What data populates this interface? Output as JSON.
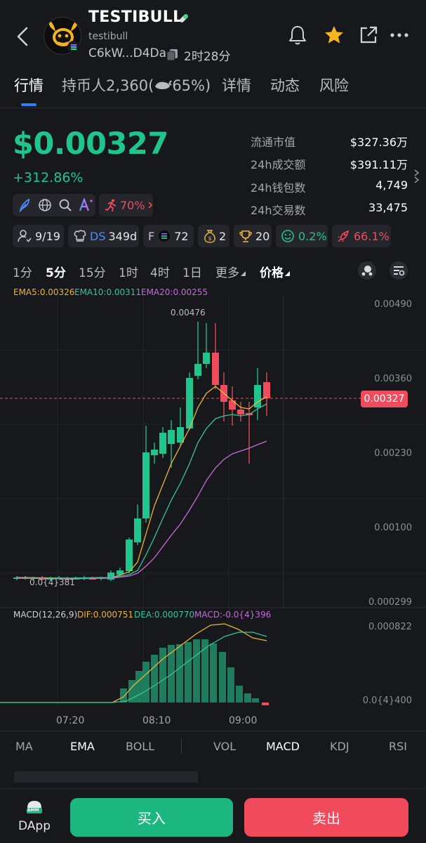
{
  "header": {
    "token_name": "TESTIBULL",
    "token_sub": "testibull",
    "address": "C6kW...D4Da",
    "age": "2时28分"
  },
  "tabs": [
    {
      "label": "行情"
    },
    {
      "label": "持币人2,360("
    },
    {
      "label": "65%)"
    },
    {
      "label": "详情"
    },
    {
      "label": "动态"
    },
    {
      "label": "风险"
    }
  ],
  "price": {
    "value": "$0.00327",
    "change": "+312.86%"
  },
  "stats": [
    {
      "label": "流通市值",
      "value": "$327.36万"
    },
    {
      "label": "24h成交额",
      "value": "$391.11万"
    },
    {
      "label": "24h钱包数",
      "value": "4,749"
    },
    {
      "label": "24h交易数",
      "value": "33,475"
    }
  ],
  "chips_row1": {
    "runner_pct": "70%"
  },
  "chips_row2": {
    "holders": "9/19",
    "ds_label": "DS",
    "ds_age": "349d",
    "f_label": "F",
    "f_value": "72",
    "bag": "2",
    "cup": "20",
    "smile": "0.2%",
    "rocket": "66.1%"
  },
  "timeframes": [
    {
      "label": "1分"
    },
    {
      "label": "5分"
    },
    {
      "label": "15分"
    },
    {
      "label": "1时"
    },
    {
      "label": "4时"
    },
    {
      "label": "1日"
    },
    {
      "label": "更多"
    },
    {
      "label": "价格"
    }
  ],
  "ema_legend": {
    "ema5": "EMA5:0.00326",
    "ema10": "EMA10:0.00311",
    "ema20": "EMA20:0.00255"
  },
  "price_axis": [
    "0.00490",
    "0.00360",
    "0.00230",
    "0.00100",
    "0.000299"
  ],
  "current_price_tag": "0.00327",
  "annotations": {
    "high": "0.00476",
    "low": "0.0{4}381"
  },
  "macd_legend": {
    "label": "MACD(12,26,9)",
    "dif": "DIF:0.000751",
    "dea": "DEA:0.000770",
    "macd": "MACD:-0.0{4}396"
  },
  "macd_axis": [
    "0.000822",
    "0.0{4}400"
  ],
  "time_axis": [
    "07:20",
    "08:10",
    "09:00"
  ],
  "indicators": [
    {
      "label": "MA"
    },
    {
      "label": "EMA"
    },
    {
      "label": "BOLL"
    },
    {
      "label": "VOL"
    },
    {
      "label": "MACD"
    },
    {
      "label": "KDJ"
    },
    {
      "label": "RSI"
    }
  ],
  "bottom": {
    "dapp": "DApp",
    "amm": "AMM",
    "buy": "买入",
    "sell": "卖出"
  },
  "colors": {
    "up": "#1fc58c",
    "down": "#ef4d5d",
    "ema5": "#e8b53a",
    "ema10": "#32c795",
    "ema20": "#c46bd9",
    "accent": "#2c7ef8"
  }
}
